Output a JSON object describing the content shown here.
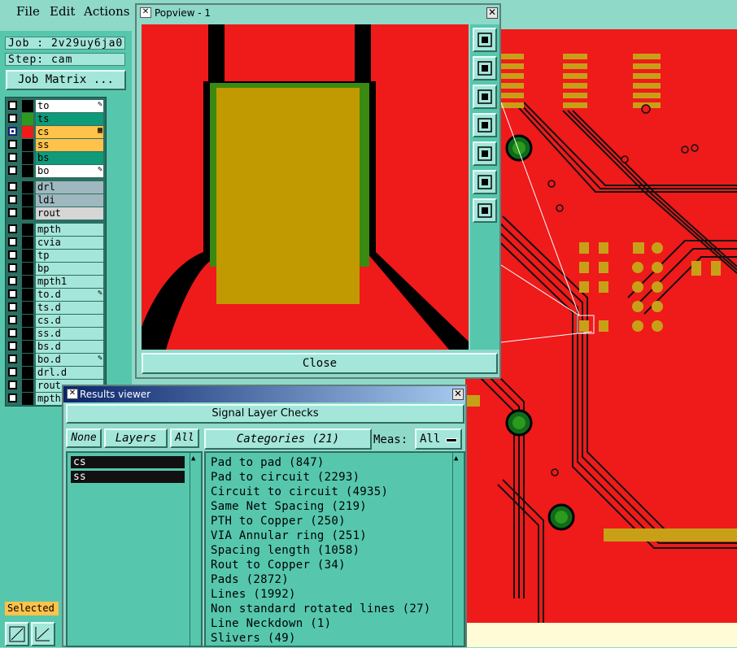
{
  "menubar": {
    "file": "File",
    "edit": "Edit",
    "actions": "Actions"
  },
  "left": {
    "job": "Job : 2v29uy6ja0",
    "step": "Step: cam",
    "job_matrix": "Job Matrix ...",
    "selected": "Selected",
    "layers": [
      {
        "name": "to",
        "color": "#ffffff",
        "swatch": "#000000",
        "icon": "pen"
      },
      {
        "name": "ts",
        "color": "#0f9a7a",
        "swatch": "#2c9a1c",
        "icon": ""
      },
      {
        "name": "cs",
        "color": "#ffc24a",
        "swatch": "#ef1a1a",
        "icon": "grid",
        "active": true
      },
      {
        "name": "ss",
        "color": "#ffc24a",
        "swatch": "#000000",
        "icon": ""
      },
      {
        "name": "bs",
        "color": "#0f9a7a",
        "swatch": "#000000",
        "icon": ""
      },
      {
        "name": "bo",
        "color": "#ffffff",
        "swatch": "#000000",
        "icon": "pen"
      },
      {
        "name": "drl",
        "color": "#9fb8bf",
        "swatch": "#000000",
        "icon": ""
      },
      {
        "name": "ldi",
        "color": "#9fb8bf",
        "swatch": "#000000",
        "icon": ""
      },
      {
        "name": "rout",
        "color": "#d6d6d6",
        "swatch": "#000000",
        "icon": ""
      },
      {
        "name": "mpth",
        "color": "#a4e6da",
        "swatch": "#000000",
        "icon": ""
      },
      {
        "name": "cvia",
        "color": "#a4e6da",
        "swatch": "#000000",
        "icon": ""
      },
      {
        "name": "tp",
        "color": "#a4e6da",
        "swatch": "#000000",
        "icon": ""
      },
      {
        "name": "bp",
        "color": "#a4e6da",
        "swatch": "#000000",
        "icon": ""
      },
      {
        "name": "mpth1",
        "color": "#a4e6da",
        "swatch": "#000000",
        "icon": ""
      },
      {
        "name": "to.d",
        "color": "#a4e6da",
        "swatch": "#000000",
        "icon": "pen"
      },
      {
        "name": "ts.d",
        "color": "#a4e6da",
        "swatch": "#000000",
        "icon": ""
      },
      {
        "name": "cs.d",
        "color": "#a4e6da",
        "swatch": "#000000",
        "icon": ""
      },
      {
        "name": "ss.d",
        "color": "#a4e6da",
        "swatch": "#000000",
        "icon": ""
      },
      {
        "name": "bs.d",
        "color": "#a4e6da",
        "swatch": "#000000",
        "icon": ""
      },
      {
        "name": "bo.d",
        "color": "#a4e6da",
        "swatch": "#000000",
        "icon": "pen"
      },
      {
        "name": "drl.d",
        "color": "#a4e6da",
        "swatch": "#000000",
        "icon": ""
      },
      {
        "name": "rout",
        "color": "#a4e6da",
        "swatch": "#000000",
        "icon": ""
      },
      {
        "name": "mpth",
        "color": "#a4e6da",
        "swatch": "#000000",
        "icon": ""
      }
    ]
  },
  "popview": {
    "title": "Popview - 1",
    "close": "Close",
    "tools": [
      "zoom-in-icon",
      "pan-up-icon",
      "pan-down-icon",
      "pan-left-icon",
      "pan-right-icon",
      "zoom-fit-icon",
      "zoom-out-icon"
    ]
  },
  "results": {
    "title": "Results viewer",
    "section": "Signal Layer Checks",
    "none": "None",
    "layers": "Layers",
    "all": "All",
    "categories_header": "Categories (21)",
    "meas_label": "Meas:",
    "meas_value": "All",
    "layer_items": [
      "cs",
      "ss"
    ],
    "categories": [
      "Pad to pad (847)",
      "Pad to circuit (2293)",
      "Circuit to circuit (4935)",
      "Same Net Spacing (219)",
      "PTH to Copper (250)",
      "VIA Annular ring (251)",
      "Spacing length (1058)",
      "Rout to Copper (34)",
      "Pads (2872)",
      "Lines (1992)",
      "Non standard rotated lines (27)",
      "Line Neckdown (1)",
      "Slivers (49)"
    ]
  },
  "colors": {
    "board": "#ef1a1a",
    "panel": "#8fd9c9",
    "accent": "#56c7ad"
  }
}
